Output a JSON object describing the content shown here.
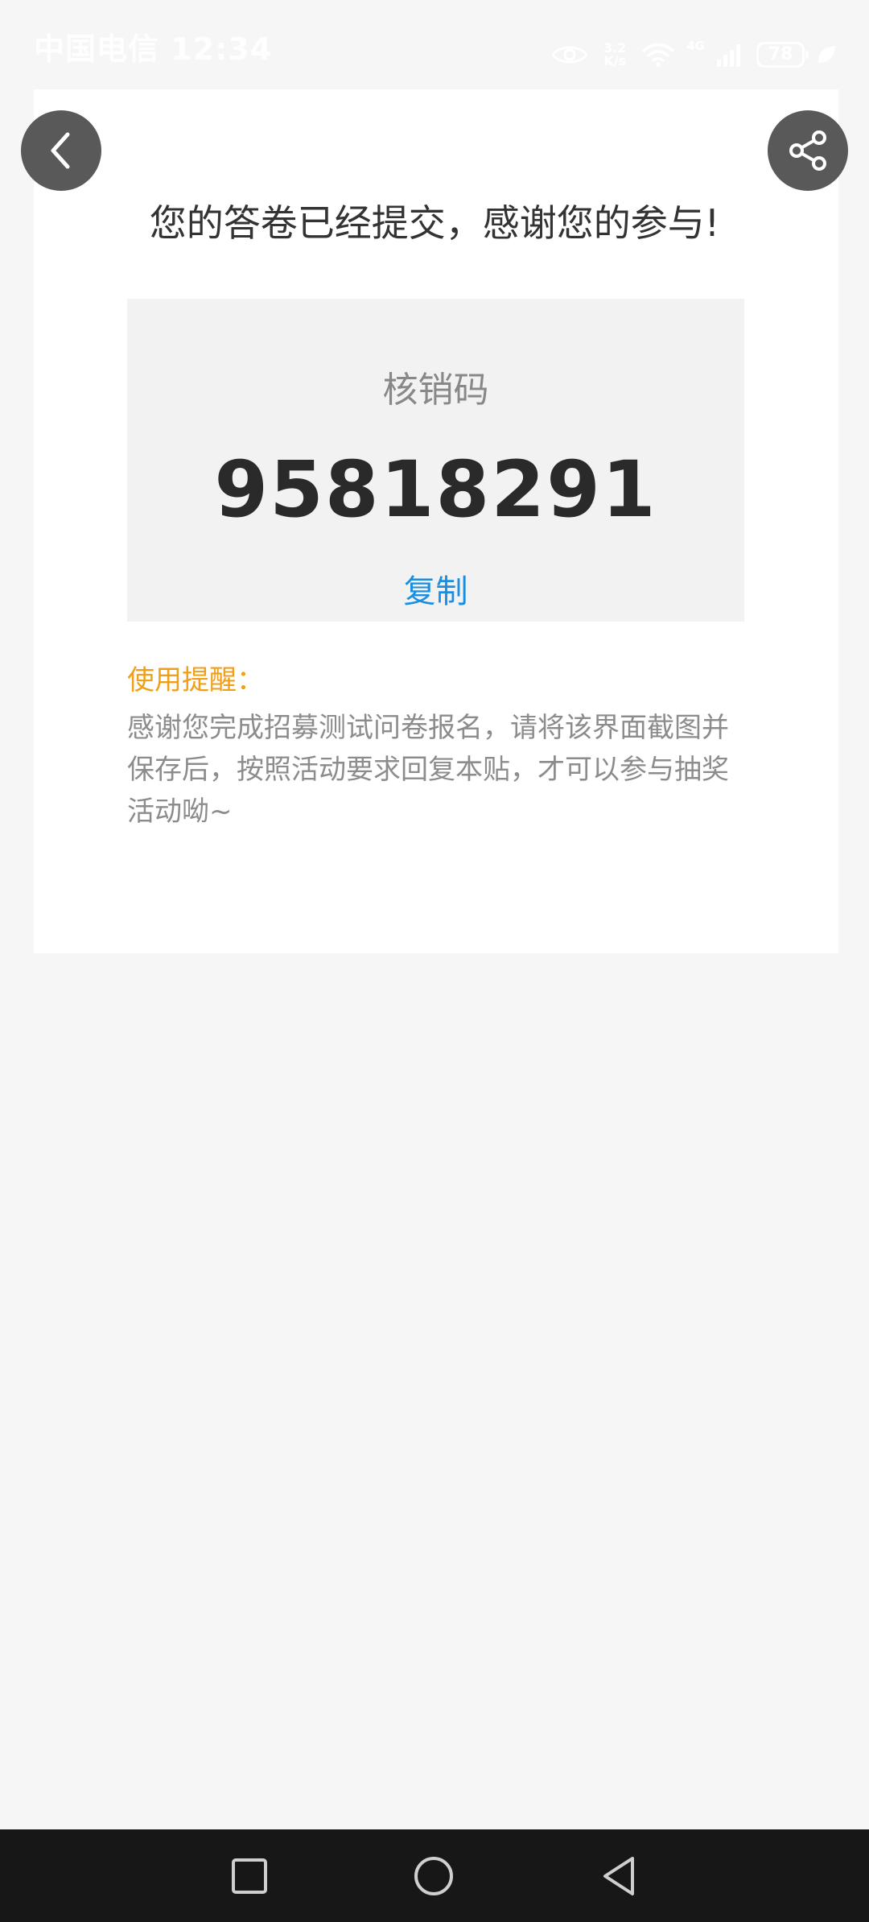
{
  "status_bar": {
    "carrier_time": "中国电信 12:34",
    "network_speed": "3.2 K/s",
    "network_type": "4G",
    "battery_level": "78",
    "icons": [
      "eye-icon",
      "wifi-icon",
      "signal-icon",
      "battery-icon",
      "leaf-icon"
    ]
  },
  "header": {
    "back_icon": "chevron-left-icon",
    "share_icon": "share-icon"
  },
  "main": {
    "title": "您的答卷已经提交，感谢您的参与!",
    "code_label": "核销码",
    "code_value": "95818291",
    "copy_label": "复制",
    "tip_title": "使用提醒：",
    "tip_text": "感谢您完成招募测试问卷报名，请将该界面截图并保存后，按照活动要求回复本贴，才可以参与抽奖活动呦~"
  },
  "nav_bar": {
    "icons": [
      "square-icon",
      "circle-icon",
      "triangle-back-icon"
    ]
  },
  "colors": {
    "page_bg": "#f6f6f6",
    "card_bg": "#ffffff",
    "code_box_bg": "#f2f2f2",
    "accent_link": "#1a8ee0",
    "tip_title": "#f0a018",
    "button_bg": "#595959",
    "nav_bar_bg": "#171717"
  }
}
